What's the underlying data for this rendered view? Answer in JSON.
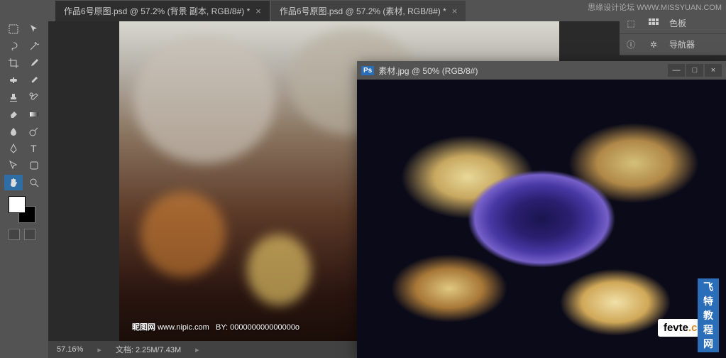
{
  "tabs": [
    {
      "label": "作品6号原图.psd @ 57.2% (背景 副本, RGB/8#) *"
    },
    {
      "label": "作品6号原图.psd @ 57.2% (素材, RGB/8#) *"
    }
  ],
  "watermark_text": "思缘设计论坛  WWW.MISSYUAN.COM",
  "right_panel": {
    "items": [
      {
        "icon": "swatch-grid-icon",
        "label": "色板"
      },
      {
        "icon": "navigator-icon",
        "label": "导航器"
      }
    ]
  },
  "status": {
    "zoom": "57.16%",
    "doc_label": "文档:",
    "doc_value": "2.25M/7.43M"
  },
  "artwork": {
    "credit_site": "昵图网",
    "credit_url": "www.nipic.com",
    "credit_by": "BY:",
    "credit_id": "000000000000000o"
  },
  "float_window": {
    "ps_icon": "Ps",
    "title": "素材.jpg @ 50% (RGB/8#)",
    "minimize": "—",
    "maximize": "□",
    "close": "×"
  },
  "logo": {
    "main": "fevte",
    "suffix": ".com",
    "sub": "飞特教程网"
  },
  "tool_names": [
    "move",
    "marquee",
    "lasso",
    "wand",
    "crop",
    "eyedropper",
    "healing",
    "brush",
    "stamp",
    "history-brush",
    "eraser",
    "gradient",
    "blur",
    "dodge",
    "pen",
    "type",
    "path-select",
    "shape",
    "hand",
    "zoom"
  ]
}
